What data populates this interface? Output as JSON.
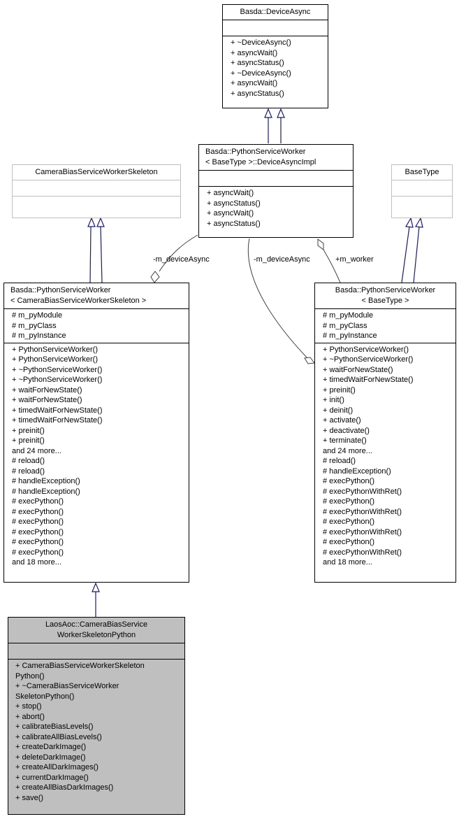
{
  "classes": {
    "device_async": {
      "title": "Basda::DeviceAsync",
      "attributes": [],
      "methods": [
        "+ ~DeviceAsync()",
        "+ asyncWait()",
        "+ asyncStatus()",
        "+ ~DeviceAsync()",
        "+ asyncWait()",
        "+ asyncStatus()"
      ]
    },
    "device_async_impl": {
      "title": "Basda::PythonServiceWorker\n< BaseType >::DeviceAsyncImpl",
      "attributes": [],
      "methods": [
        "+ asyncWait()",
        "+ asyncStatus()",
        "+ asyncWait()",
        "+ asyncStatus()"
      ]
    },
    "skeleton": {
      "title": "CameraBiasServiceWorkerSkeleton",
      "attributes": [],
      "methods": []
    },
    "base_type": {
      "title": "BaseType",
      "attributes": [],
      "methods": []
    },
    "psw_skeleton": {
      "title": "Basda::PythonServiceWorker\n< CameraBiasServiceWorkerSkeleton >",
      "attributes": [
        "# m_pyModule",
        "# m_pyClass",
        "# m_pyInstance"
      ],
      "methods": [
        "+ PythonServiceWorker()",
        "+ PythonServiceWorker()",
        "+ ~PythonServiceWorker()",
        "+ ~PythonServiceWorker()",
        "+ waitForNewState()",
        "+ waitForNewState()",
        "+ timedWaitForNewState()",
        "+ timedWaitForNewState()",
        "+ preinit()",
        "+ preinit()",
        "and 24 more...",
        "# reload()",
        "# reload()",
        "# handleException()",
        "# handleException()",
        "# execPython()",
        "# execPython()",
        "# execPython()",
        "# execPython()",
        "# execPython()",
        "# execPython()",
        "and 18 more..."
      ]
    },
    "psw_basetype": {
      "title": "Basda::PythonServiceWorker\n< BaseType >",
      "attributes": [
        "# m_pyModule",
        "# m_pyClass",
        "# m_pyInstance"
      ],
      "methods": [
        "+ PythonServiceWorker()",
        "+ ~PythonServiceWorker()",
        "+ waitForNewState()",
        "+ timedWaitForNewState()",
        "+ preinit()",
        "+ init()",
        "+ deinit()",
        "+ activate()",
        "+ deactivate()",
        "+ terminate()",
        "and 24 more...",
        "# reload()",
        "# handleException()",
        "# execPython()",
        "# execPythonWithRet()",
        "# execPython()",
        "# execPythonWithRet()",
        "# execPython()",
        "# execPythonWithRet()",
        "# execPython()",
        "# execPythonWithRet()",
        "and 18 more..."
      ]
    },
    "laos_python": {
      "title": "LaosAoc::CameraBiasService\nWorkerSkeletonPython",
      "attributes": [],
      "methods": [
        "+ CameraBiasServiceWorkerSkeleton",
        "Python()",
        "+ ~CameraBiasServiceWorker",
        "SkeletonPython()",
        "+ stop()",
        "+ abort()",
        "+ calibrateBiasLevels()",
        "+ calibrateAllBiasLevels()",
        "+ createDarkImage()",
        "+ deleteDarkImage()",
        "+ createAllDarkImages()",
        "+ currentDarkImage()",
        "+ createAllBiasDarkImages()",
        "+ save()"
      ]
    }
  },
  "edge_labels": {
    "left_device_async": "-m_deviceAsync",
    "right_device_async": "-m_deviceAsync",
    "worker": "+m_worker"
  },
  "colors": {
    "inheritance_edge": "#191970",
    "association_edge": "#404040",
    "focus_fill": "#bfbfbf",
    "external_border": "#bfbfbf"
  }
}
